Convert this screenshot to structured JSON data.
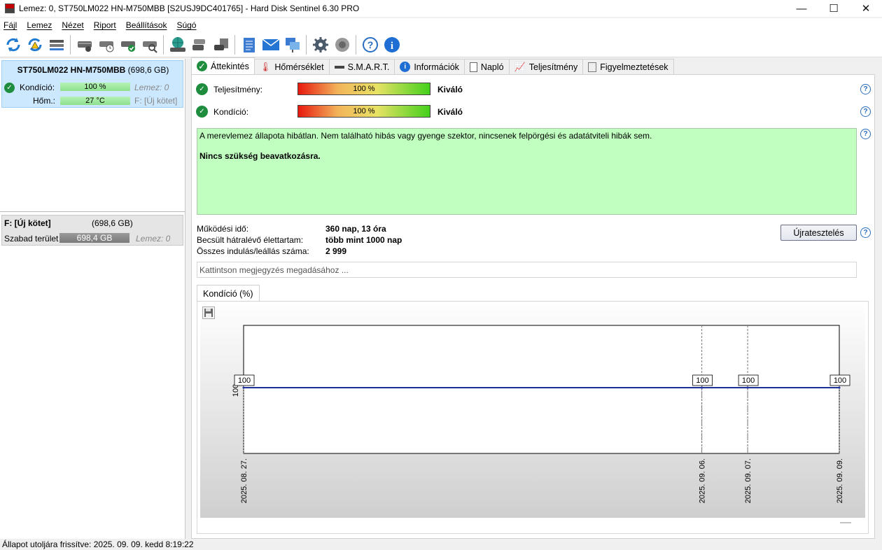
{
  "window": {
    "title": "Lemez: 0, ST750LM022 HN-M750MBB [S2USJ9DC401765]  -  Hard Disk Sentinel 6.30 PRO",
    "minimize": "—",
    "maximize": "☐",
    "close": "✕"
  },
  "menu": [
    "Fájl",
    "Lemez",
    "Nézet",
    "Riport",
    "Beállítások",
    "Súgó"
  ],
  "toolbar": {
    "icons": [
      "refresh-icon",
      "refresh-warning-icon",
      "disk-list-icon",
      "disk-info-icon",
      "disk-schedule-icon",
      "disk-ok-icon",
      "disk-search-icon",
      "globe-disk-icon",
      "disk-copy-icon",
      "disk-backup-icon",
      "notepad-icon",
      "mail-icon",
      "network-icon",
      "settings-gear-icon",
      "speaker-icon",
      "help-icon",
      "info-icon"
    ]
  },
  "disk": {
    "name": "ST750LM022 HN-M750MBB",
    "size": "(698,6 GB)",
    "condition_label": "Kondíció:",
    "condition_value": "100 %",
    "condition_disk": "Lemez: 0",
    "temp_label": "Hőm.:",
    "temp_value": "27 °C",
    "temp_volume": "F: [Új kötet]"
  },
  "volume": {
    "name": "F: [Új kötet]",
    "size": "(698,6 GB)",
    "free_label": "Szabad terület",
    "free_value": "698,4 GB",
    "disk": "Lemez: 0"
  },
  "tabs": [
    {
      "label": "Áttekintés",
      "icon": "check-icon"
    },
    {
      "label": "Hőmérséklet",
      "icon": "thermometer-icon"
    },
    {
      "label": "S.M.A.R.T.",
      "icon": "smart-icon"
    },
    {
      "label": "Információk",
      "icon": "info-icon"
    },
    {
      "label": "Napló",
      "icon": "log-icon"
    },
    {
      "label": "Teljesítmény",
      "icon": "performance-icon"
    },
    {
      "label": "Figyelmeztetések",
      "icon": "alerts-icon"
    }
  ],
  "overview": {
    "performance_label": "Teljesítmény:",
    "performance_value": "100 %",
    "performance_rating": "Kiváló",
    "condition_label": "Kondíció:",
    "condition_value": "100 %",
    "condition_rating": "Kiváló",
    "message": "A merevlemez állapota hibátlan. Nem található hibás vagy gyenge szektor, nincsenek felpörgési és adatátviteli hibák sem.",
    "advice": "Nincs szükség beavatkozásra.",
    "uptime_label": "Működési idő:",
    "uptime_value": "360 nap, 13 óra",
    "lifetime_label": "Becsült hátralévő élettartam:",
    "lifetime_value": "több mint 1000 nap",
    "starts_label": "Összes indulás/leállás száma:",
    "starts_value": "2 999",
    "retest_button": "Újratesztelés",
    "note_placeholder": "Kattintson megjegyzés megadásához ..."
  },
  "chart_tab": "Kondíció  (%)",
  "chart_data": {
    "type": "line",
    "title": "",
    "x": [
      "2025. 08. 27.",
      "2025. 09. 06.",
      "2025. 09. 07.",
      "2025. 09. 09."
    ],
    "series": [
      {
        "values": [
          100,
          100,
          100,
          100
        ]
      }
    ],
    "ytick": "100",
    "ylabel": "",
    "xlabel": ""
  },
  "status": "Állapot utoljára frissítve: 2025. 09. 09. kedd 8:19:22"
}
